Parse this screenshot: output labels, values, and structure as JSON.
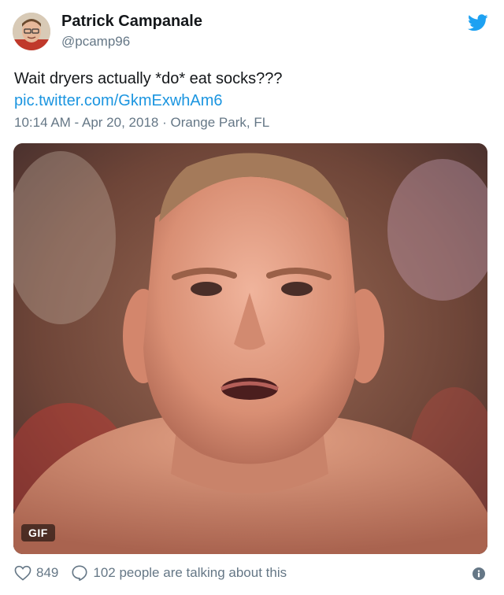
{
  "author": {
    "name": "Patrick Campanale",
    "handle": "@pcamp96"
  },
  "tweet": {
    "text": "Wait dryers actually *do* eat socks???",
    "link": "pic.twitter.com/GkmExwhAm6",
    "time": "10:14 AM - Apr 20, 2018",
    "separator": "·",
    "location": "Orange Park, FL"
  },
  "media": {
    "badge": "GIF"
  },
  "footer": {
    "likes": "849",
    "replies_text": "102 people are talking about this"
  },
  "icons": {
    "brand": "twitter-bird-icon",
    "like": "heart-icon",
    "reply": "speech-bubble-icon",
    "info": "info-icon"
  },
  "colors": {
    "text": "#14171a",
    "secondary": "#657786",
    "link": "#1b95e0",
    "brand": "#1da1f2"
  }
}
